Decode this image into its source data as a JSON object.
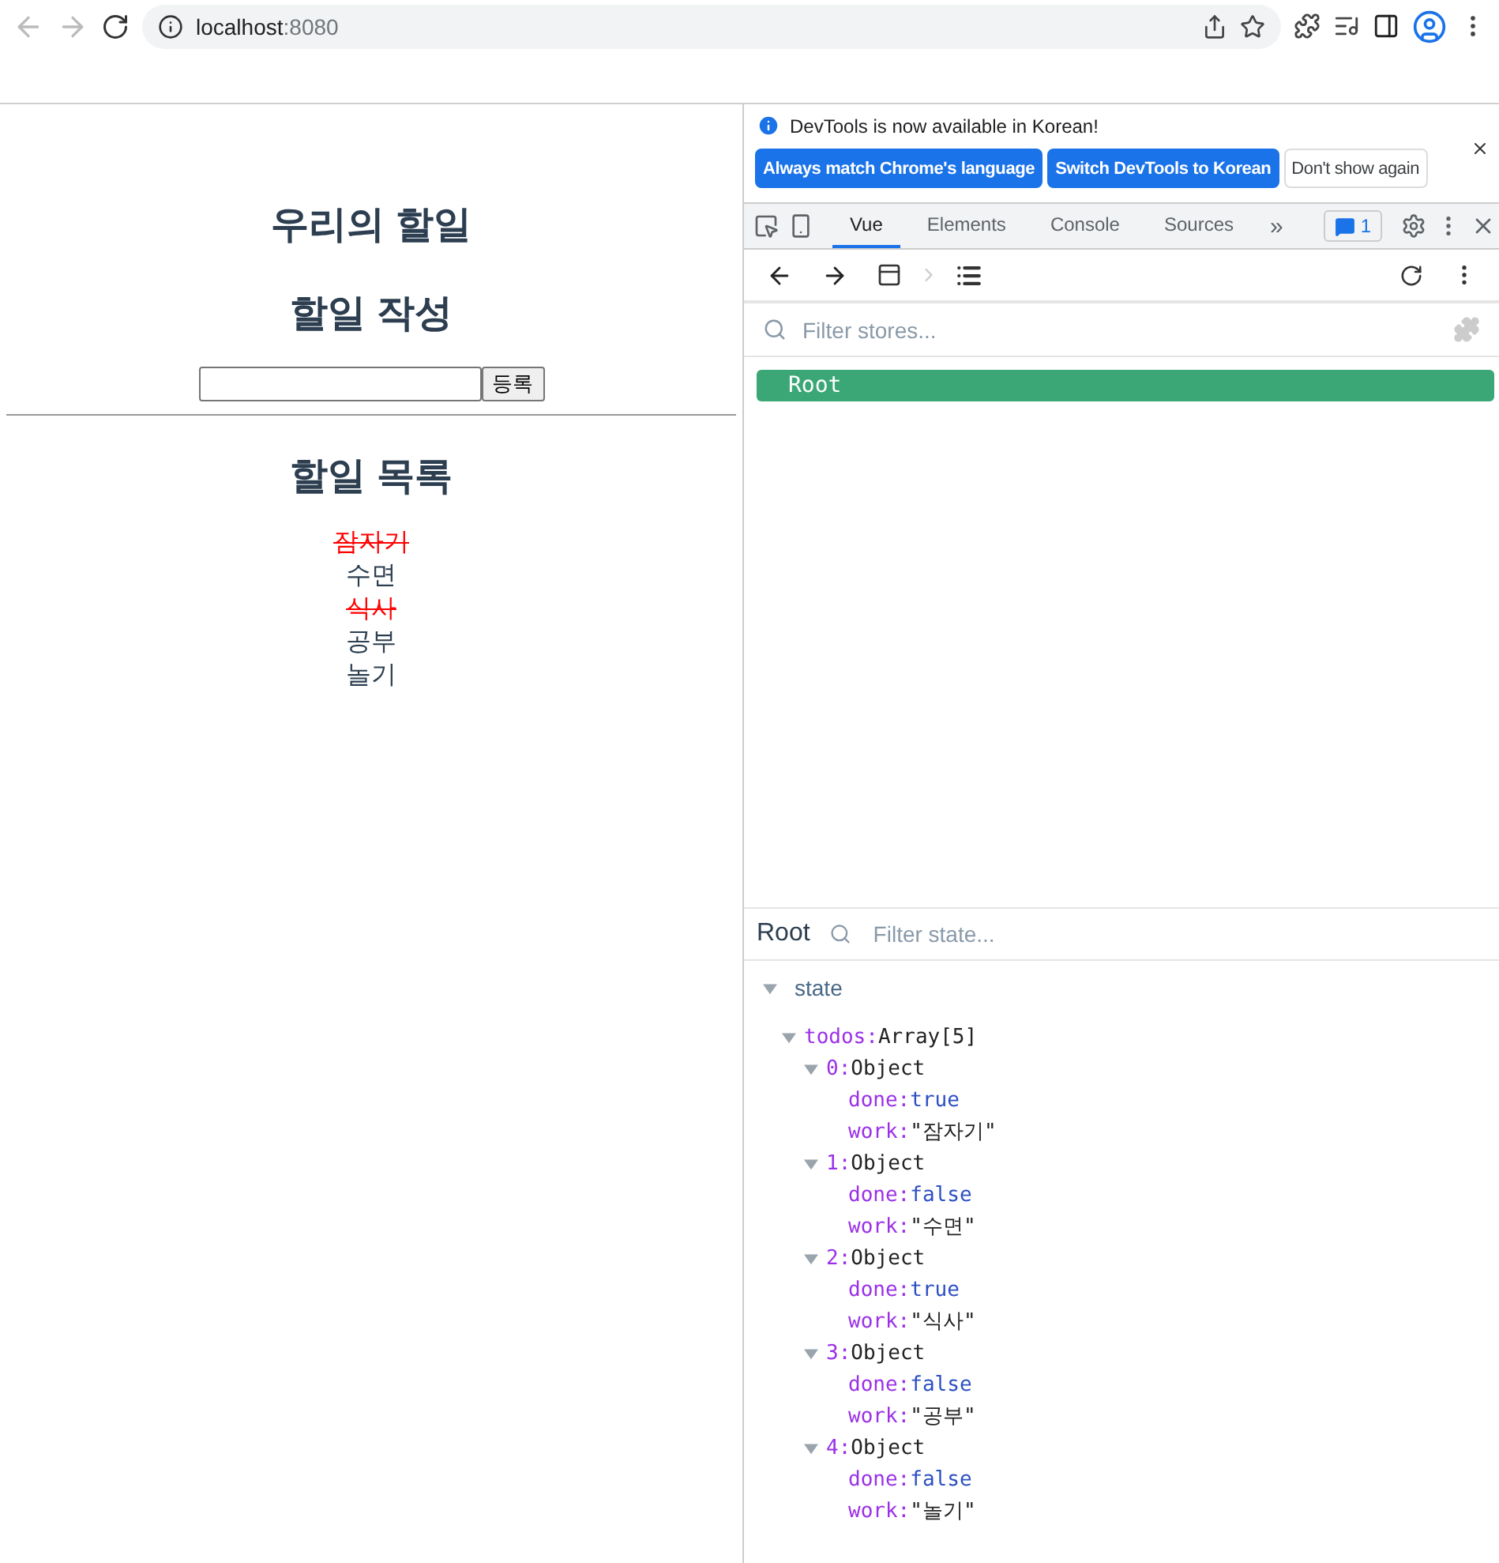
{
  "browser": {
    "host": "localhost",
    "port": ":8080"
  },
  "app": {
    "title": "우리의 할일",
    "form_title": "할일 작성",
    "submit": "등록",
    "list_title": "할일 목록",
    "todos": [
      {
        "work": "잠자기",
        "done": true
      },
      {
        "work": "수면",
        "done": false
      },
      {
        "work": "식사",
        "done": true
      },
      {
        "work": "공부",
        "done": false
      },
      {
        "work": "놀기",
        "done": false
      }
    ]
  },
  "devtools": {
    "notice": {
      "text": "DevTools is now available in Korean!",
      "buttons": [
        {
          "label": "Always match Chrome's language",
          "kind": "primary"
        },
        {
          "label": "Switch DevTools to Korean",
          "kind": "primary"
        },
        {
          "label": "Don't show again",
          "kind": "plain"
        }
      ]
    },
    "tabs": [
      {
        "label": "Vue",
        "selected": true
      },
      {
        "label": "Elements",
        "selected": false
      },
      {
        "label": "Console",
        "selected": false
      },
      {
        "label": "Sources",
        "selected": false
      }
    ],
    "more_tabs": "»",
    "issues_count": "1",
    "store_filter": {
      "placeholder": "Filter stores..."
    },
    "stores": [
      {
        "name": "Root",
        "selected": true
      }
    ],
    "state_panel": {
      "title": "Root",
      "filter_placeholder": "Filter state...",
      "section": "state",
      "section_expanded": true,
      "tree": [
        {
          "key": "todos:",
          "summary": "Array[5]",
          "expanded": true,
          "children": [
            {
              "key": "0:",
              "summary": "Object",
              "expanded": true,
              "children": [
                {
                  "key": "done:",
                  "value": "true",
                  "kind": "boolean"
                },
                {
                  "key": "work:",
                  "value": "\"잠자기\"",
                  "kind": "string"
                }
              ]
            },
            {
              "key": "1:",
              "summary": "Object",
              "expanded": true,
              "children": [
                {
                  "key": "done:",
                  "value": "false",
                  "kind": "boolean"
                },
                {
                  "key": "work:",
                  "value": "\"수면\"",
                  "kind": "string"
                }
              ]
            },
            {
              "key": "2:",
              "summary": "Object",
              "expanded": true,
              "children": [
                {
                  "key": "done:",
                  "value": "true",
                  "kind": "boolean"
                },
                {
                  "key": "work:",
                  "value": "\"식사\"",
                  "kind": "string"
                }
              ]
            },
            {
              "key": "3:",
              "summary": "Object",
              "expanded": true,
              "children": [
                {
                  "key": "done:",
                  "value": "false",
                  "kind": "boolean"
                },
                {
                  "key": "work:",
                  "value": "\"공부\"",
                  "kind": "string"
                }
              ]
            },
            {
              "key": "4:",
              "summary": "Object",
              "expanded": true,
              "children": [
                {
                  "key": "done:",
                  "value": "false",
                  "kind": "boolean"
                },
                {
                  "key": "work:",
                  "value": "\"놀기\"",
                  "kind": "string"
                }
              ]
            }
          ]
        }
      ]
    }
  }
}
